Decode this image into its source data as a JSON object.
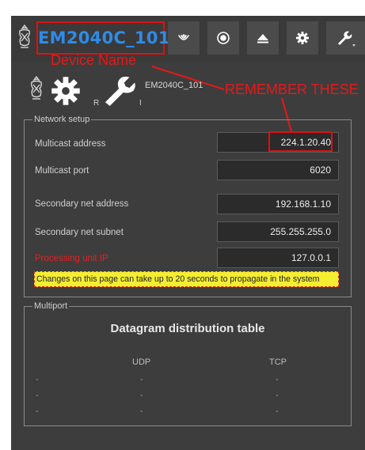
{
  "toolbar": {
    "device_title": "EM2040C_101",
    "buttons": [
      {
        "icon": "sonar-ping-icon"
      },
      {
        "icon": "record-icon"
      },
      {
        "icon": "eject-icon"
      },
      {
        "icon": "gear-icon"
      },
      {
        "icon": "wrench-dropdown-icon"
      }
    ]
  },
  "annotations": {
    "device_name": "Device Name",
    "remember": "REMEMBER THESE",
    "color": "#e81818"
  },
  "device_row": {
    "gear_letter": "R",
    "wrench_letter": "I",
    "device_label": "EM2040C_101"
  },
  "network_setup": {
    "legend": "Network setup",
    "rows": [
      {
        "label": "Multicast address",
        "value": "224.1.20.40"
      },
      {
        "label": "Multicast port",
        "value": "6020"
      },
      {
        "label": "Secondary net address",
        "value": "192.168.1.10"
      },
      {
        "label": "Secondary net subnet",
        "value": "255.255.255.0"
      },
      {
        "label": "Processing unit IP",
        "value": "127.0.0.1"
      }
    ],
    "warning": "Changes on this page can take up to 20 seconds to propagate in the system"
  },
  "multiport": {
    "legend": "Multiport",
    "title": "Datagram distribution table",
    "columns": [
      "UDP",
      "TCP"
    ],
    "rows": [
      [
        "-",
        "-",
        "-"
      ],
      [
        "-",
        "-",
        "-"
      ],
      [
        "-",
        "-",
        "-"
      ]
    ]
  },
  "colors": {
    "panel_bg": "#3d3d3d",
    "title_blue": "#2f8be6",
    "alert_red": "#e01010",
    "warning_yellow": "#f4ee33"
  }
}
